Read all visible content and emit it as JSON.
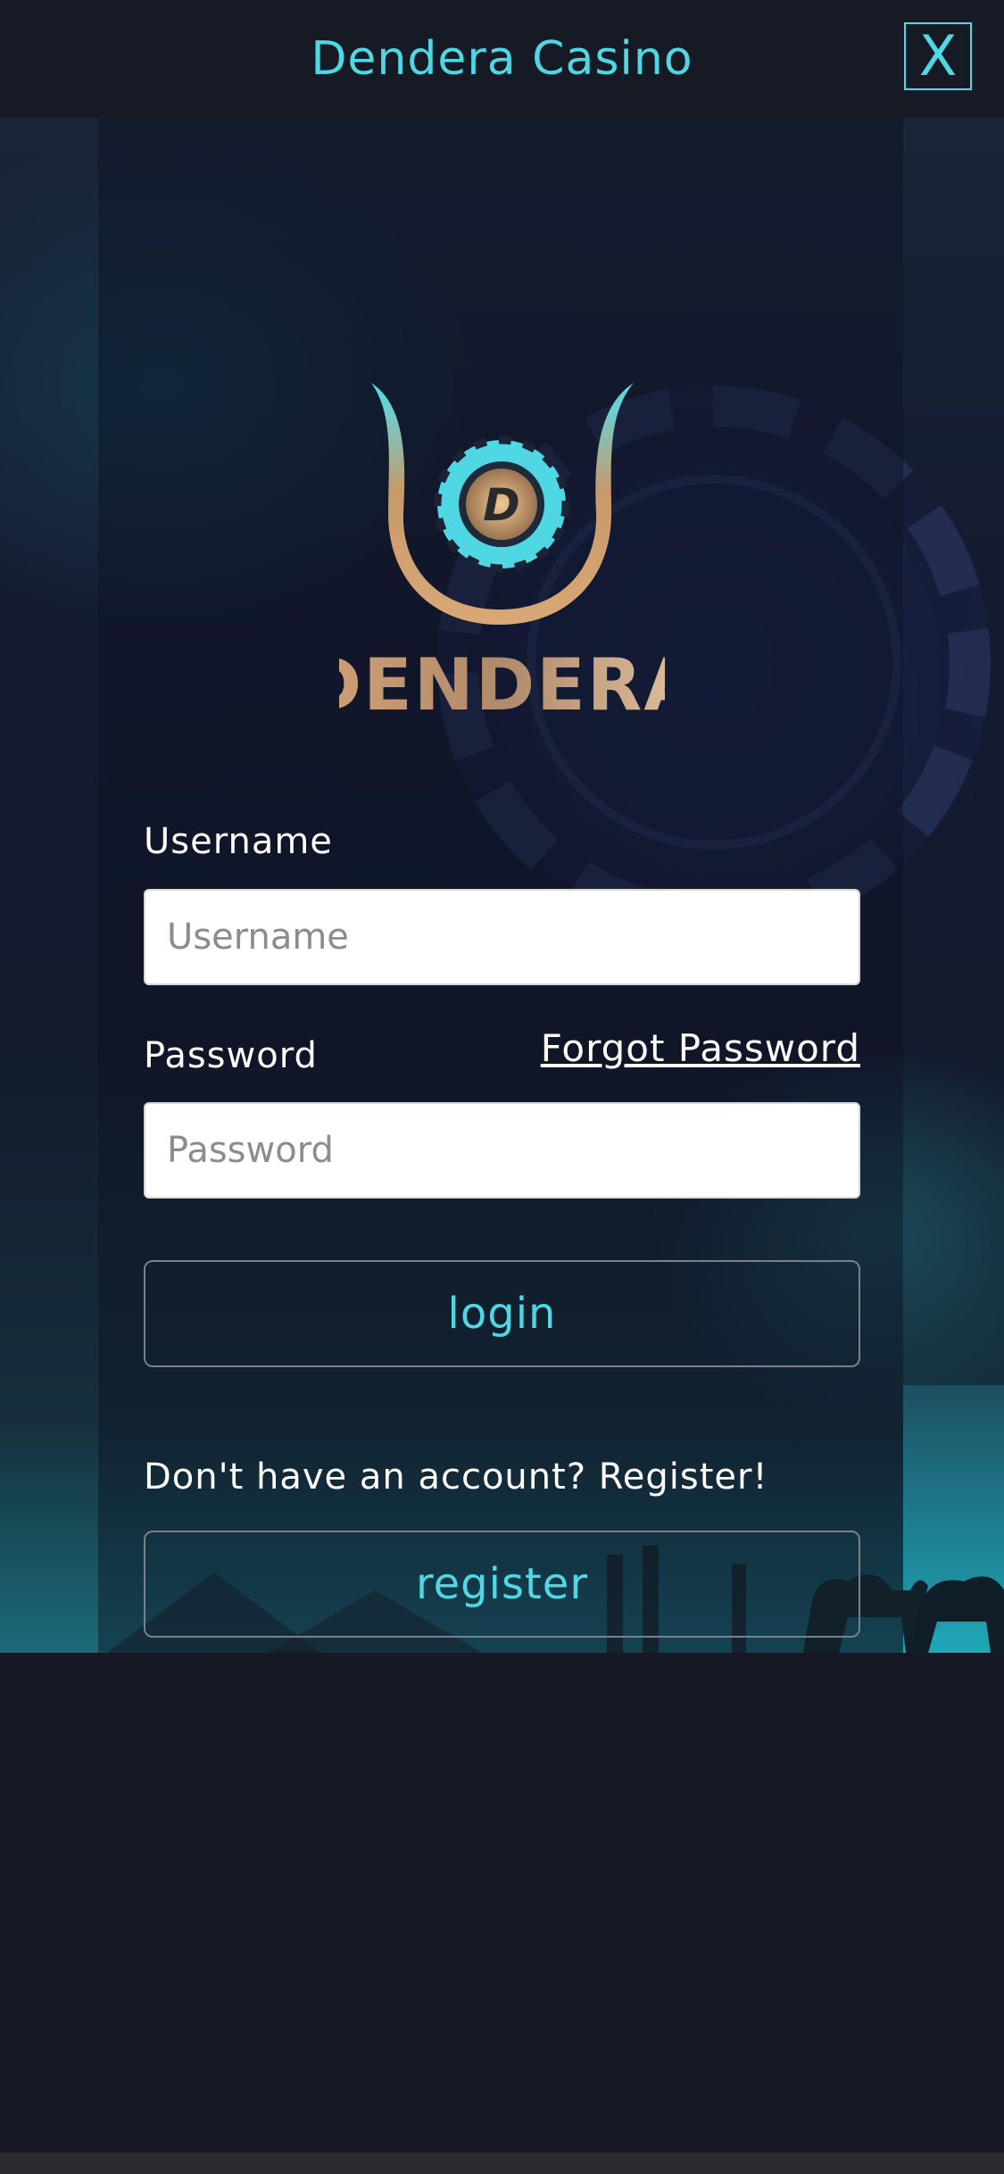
{
  "header": {
    "title": "Dendera Casino",
    "close_label": "X"
  },
  "logo": {
    "wordmark": "DENDERA",
    "emblem_letter": "D"
  },
  "form": {
    "username_label": "Username",
    "username_placeholder": "Username",
    "username_value": "",
    "password_label": "Password",
    "password_placeholder": "Password",
    "password_value": "",
    "forgot_password": "Forgot Password",
    "login_label": "login",
    "register_prompt": "Don't have an account? Register!",
    "register_label": "register"
  },
  "colors": {
    "accent": "#4fd7e4",
    "background": "#161925",
    "logo_gold": "#c99a6a"
  }
}
